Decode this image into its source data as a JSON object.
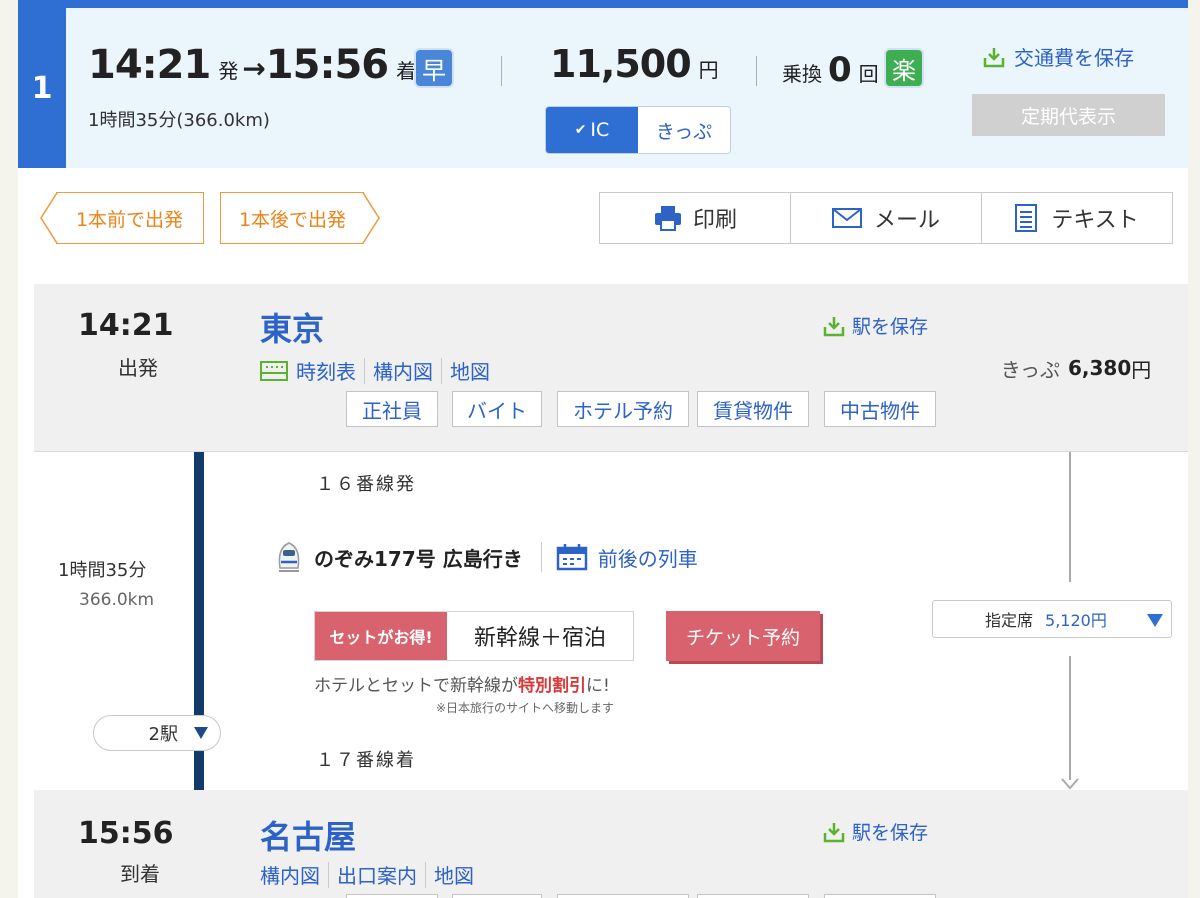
{
  "route": {
    "number": "1",
    "depart_time": "14:21",
    "depart_suffix": "発",
    "arrow": "→",
    "arrive_time": "15:56",
    "arrive_suffix": "着",
    "badge_fast": "早",
    "badge_easy": "楽",
    "duration_distance": "1時間35分(366.0km)",
    "fare": "11,500",
    "fare_unit": "円",
    "transfer_label": "乗換",
    "transfer_count": "0",
    "transfer_unit": "回",
    "save_cost_label": "交通費を保存",
    "commuter_label": "定期代表示",
    "ic_label": "IC",
    "ticket_label": "きっぷ",
    "ic_selected": true
  },
  "nav": {
    "prev_label": "1本前で出発",
    "next_label": "1本後で出発",
    "print_label": "印刷",
    "mail_label": "メール",
    "text_label": "テキスト"
  },
  "departure": {
    "time": "14:21",
    "status": "出発",
    "station": "東京",
    "save_label": "駅を保存",
    "links": [
      "時刻表",
      "構内図",
      "地図"
    ],
    "tags": [
      "正社員",
      "バイト",
      "ホテル予約",
      "賃貸物件",
      "中古物件"
    ],
    "fare_label": "きっぷ",
    "fare_value": "6,380",
    "fare_unit": "円"
  },
  "segment": {
    "platform_from": "１６番線発",
    "duration": "1時間35分",
    "distance": "366.0km",
    "train_name": "のぞみ177号 広島行き",
    "adjacent_trains": "前後の列車",
    "promo_badge": "セットがお得!",
    "promo_title": "新幹線＋宿泊",
    "ticket_reserve": "チケット予約",
    "promo_note_pre": "ホテルとセットで新幹線が",
    "promo_note_highlight": "特別割引",
    "promo_note_post": "に!",
    "promo_sub": "※日本旅行のサイトへ移動します",
    "stops_label": "2駅",
    "seat_label": "指定席",
    "seat_price": "5,120円",
    "platform_to": "１７番線着"
  },
  "arrival": {
    "time": "15:56",
    "status": "到着",
    "station": "名古屋",
    "save_label": "駅を保存",
    "links": [
      "構内図",
      "出口案内",
      "地図"
    ]
  },
  "colors": {
    "brand_blue": "#2f6fd3",
    "header_bg": "#eaf5fc",
    "orange": "#ee9a3a",
    "green": "#5ab22f",
    "promo_red": "#d9626f",
    "line_navy": "#123a6b"
  }
}
